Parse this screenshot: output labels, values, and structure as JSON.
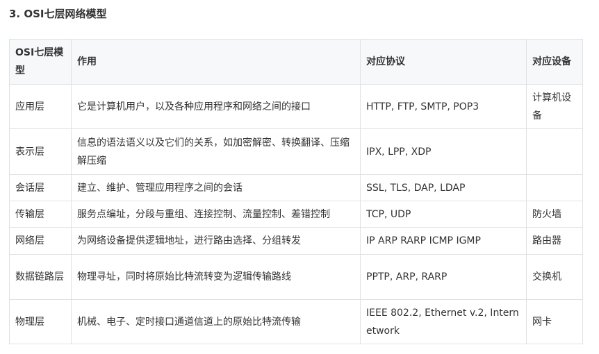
{
  "heading": "3. OSI七层网络模型",
  "table": {
    "headers": [
      "OSI七层模型",
      "作用",
      "对应协议",
      "对应设备"
    ],
    "rows": [
      {
        "layer": "应用层",
        "function": "它是计算机用户，以及各种应用程序和网络之间的接口",
        "protocols": "HTTP, FTP, SMTP, POP3",
        "device": "计算机设备"
      },
      {
        "layer": "表示层",
        "function": "信息的语法语义以及它们的关系，如加密解密、转换翻译、压缩解压缩",
        "protocols": "IPX, LPP, XDP",
        "device": ""
      },
      {
        "layer": "会话层",
        "function": "建立、维护、管理应用程序之间的会话",
        "protocols": "SSL, TLS, DAP, LDAP",
        "device": ""
      },
      {
        "layer": "传输层",
        "function": "服务点编址，分段与重组、连接控制、流量控制、差错控制",
        "protocols": "TCP, UDP",
        "device": "防火墙"
      },
      {
        "layer": "网络层",
        "function": "为网络设备提供逻辑地址，进行路由选择、分组转发",
        "protocols": "IP ARP RARP ICMP IGMP",
        "device": "路由器"
      },
      {
        "layer": "数据链路层",
        "function": "物理寻址，同时将原始比特流转变为逻辑传输路线",
        "protocols": "PPTP, ARP, RARP",
        "device": "交换机"
      },
      {
        "layer": "物理层",
        "function": "机械、电子、定时接口通道信道上的原始比特流传输",
        "protocols": "IEEE 802.2, Ethernet v.2, Internetwork",
        "device": "网卡"
      }
    ]
  }
}
